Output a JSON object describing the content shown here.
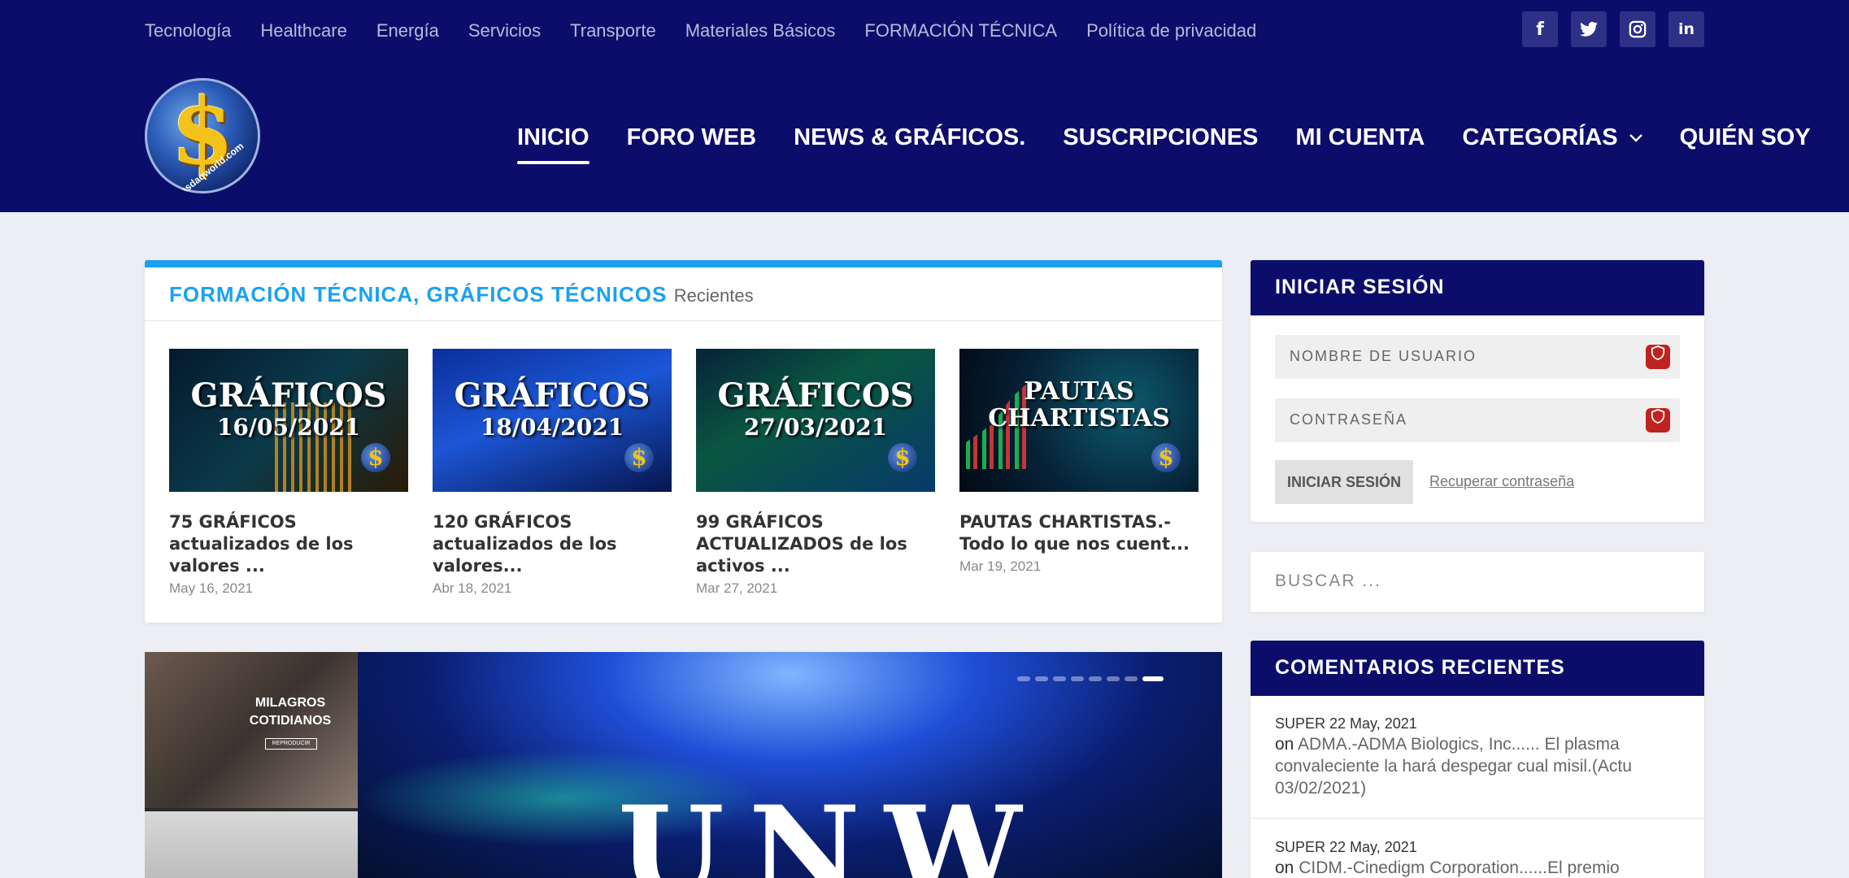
{
  "topnav": [
    "Tecnología",
    "Healthcare",
    "Energía",
    "Servicios",
    "Transporte",
    "Materiales Básicos",
    "FORMACIÓN TÉCNICA",
    "Política de privacidad"
  ],
  "social": [
    {
      "icon": "facebook-icon",
      "glyph": "f"
    },
    {
      "icon": "twitter-icon",
      "glyph": "t"
    },
    {
      "icon": "instagram-icon",
      "glyph": "◎"
    },
    {
      "icon": "linkedin-icon",
      "glyph": "in"
    }
  ],
  "logo": {
    "symbol": "$",
    "ring_text": "nasdaqworld.com"
  },
  "mainnav": [
    {
      "label": "INICIO",
      "active": true
    },
    {
      "label": "FORO WEB"
    },
    {
      "label": "NEWS & GRÁFICOS."
    },
    {
      "label": "SUSCRIPCIONES"
    },
    {
      "label": "MI CUENTA"
    },
    {
      "label": "CATEGORÍAS",
      "dropdown": true
    },
    {
      "label": "QUIÉN SOY"
    }
  ],
  "featured": {
    "title": "FORMACIÓN TÉCNICA, GRÁFICOS TÉCNICOS",
    "subtitle": "Recientes",
    "posts": [
      {
        "thumb_title": "GRÁFICOS",
        "thumb_date": "16/05/2021",
        "title": "75 GRÁFICOS actualizados de los valores ...",
        "date": "May 16, 2021"
      },
      {
        "thumb_title": "GRÁFICOS",
        "thumb_date": "18/04/2021",
        "title": "120 GRÁFICOS actualizados de los valores...",
        "date": "Abr 18, 2021"
      },
      {
        "thumb_title": "GRÁFICOS",
        "thumb_date": "27/03/2021",
        "title": "99 GRÁFICOS ACTUALIZADOS de los activos ...",
        "date": "Mar 27, 2021"
      },
      {
        "thumb_title": "PAUTAS",
        "thumb_date": "CHARTISTAS",
        "title": "PAUTAS CHARTISTAS.- Todo lo que nos cuent...",
        "date": "Mar 19, 2021"
      }
    ]
  },
  "slider": {
    "side_caption": "MILAGROS COTIDIANOS",
    "side_caption_small": "REPRODUCIR",
    "main_word": "UNW",
    "slide_count": 8,
    "active_slide": 8
  },
  "login": {
    "title": "INICIAR SESIÓN",
    "username_placeholder": "NOMBRE DE USUARIO",
    "password_placeholder": "CONTRASEÑA",
    "button": "INICIAR SESIÓN",
    "recover": "Recuperar contraseña"
  },
  "search": {
    "placeholder": "BUSCAR ..."
  },
  "comments": {
    "title": "COMENTARIOS RECIENTES",
    "items": [
      {
        "author": "SUPER",
        "date": "22 May, 2021",
        "on": "on",
        "link": "ADMA.-ADMA Biologics, Inc...... El plasma convaleciente la hará despegar cual misil.(Actu 03/02/2021)"
      },
      {
        "author": "SUPER",
        "date": "22 May, 2021",
        "on": "on",
        "link": "CIDM.-Cinedigm Corporation......El premio"
      }
    ]
  },
  "colors": {
    "header": "#0c0d6b",
    "accent": "#1aa1f2",
    "page_bg": "#eceef3"
  }
}
